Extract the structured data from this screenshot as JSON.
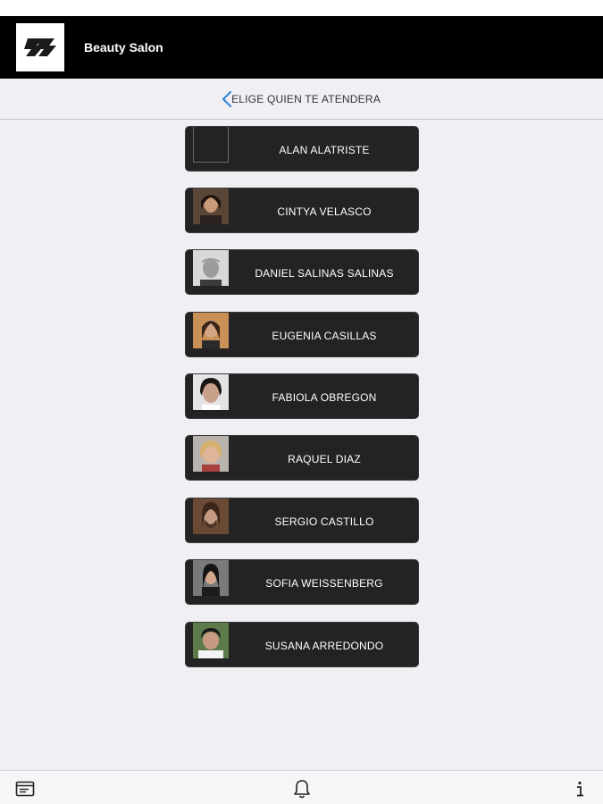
{
  "header": {
    "title": "Beauty Salon",
    "logo_icon": "ss-logo-icon"
  },
  "subheader": {
    "title": "ELIGE QUIEN TE ATENDERA",
    "back_icon": "chevron-left-icon",
    "accent": "#2a7fd4"
  },
  "stylists": [
    {
      "name": "ALAN ALATRISTE",
      "photo": "none"
    },
    {
      "name": "CINTYA VELASCO",
      "photo": "woman-dark-hair"
    },
    {
      "name": "DANIEL SALINAS SALINAS",
      "photo": "man-bw"
    },
    {
      "name": "EUGENIA CASILLAS",
      "photo": "woman-warm"
    },
    {
      "name": "FABIOLA OBREGON",
      "photo": "woman-dark-bob"
    },
    {
      "name": "RAQUEL DIAZ",
      "photo": "woman-blonde"
    },
    {
      "name": "SERGIO CASTILLO",
      "photo": "man-long-hair"
    },
    {
      "name": "SOFIA WEISSENBERG",
      "photo": "woman-gray-bg"
    },
    {
      "name": "SUSANA ARREDONDO",
      "photo": "woman-outdoor"
    }
  ],
  "bottom_bar": {
    "items": [
      {
        "icon": "calendar-list-icon"
      },
      {
        "icon": "bell-icon"
      },
      {
        "icon": "info-icon"
      }
    ]
  }
}
